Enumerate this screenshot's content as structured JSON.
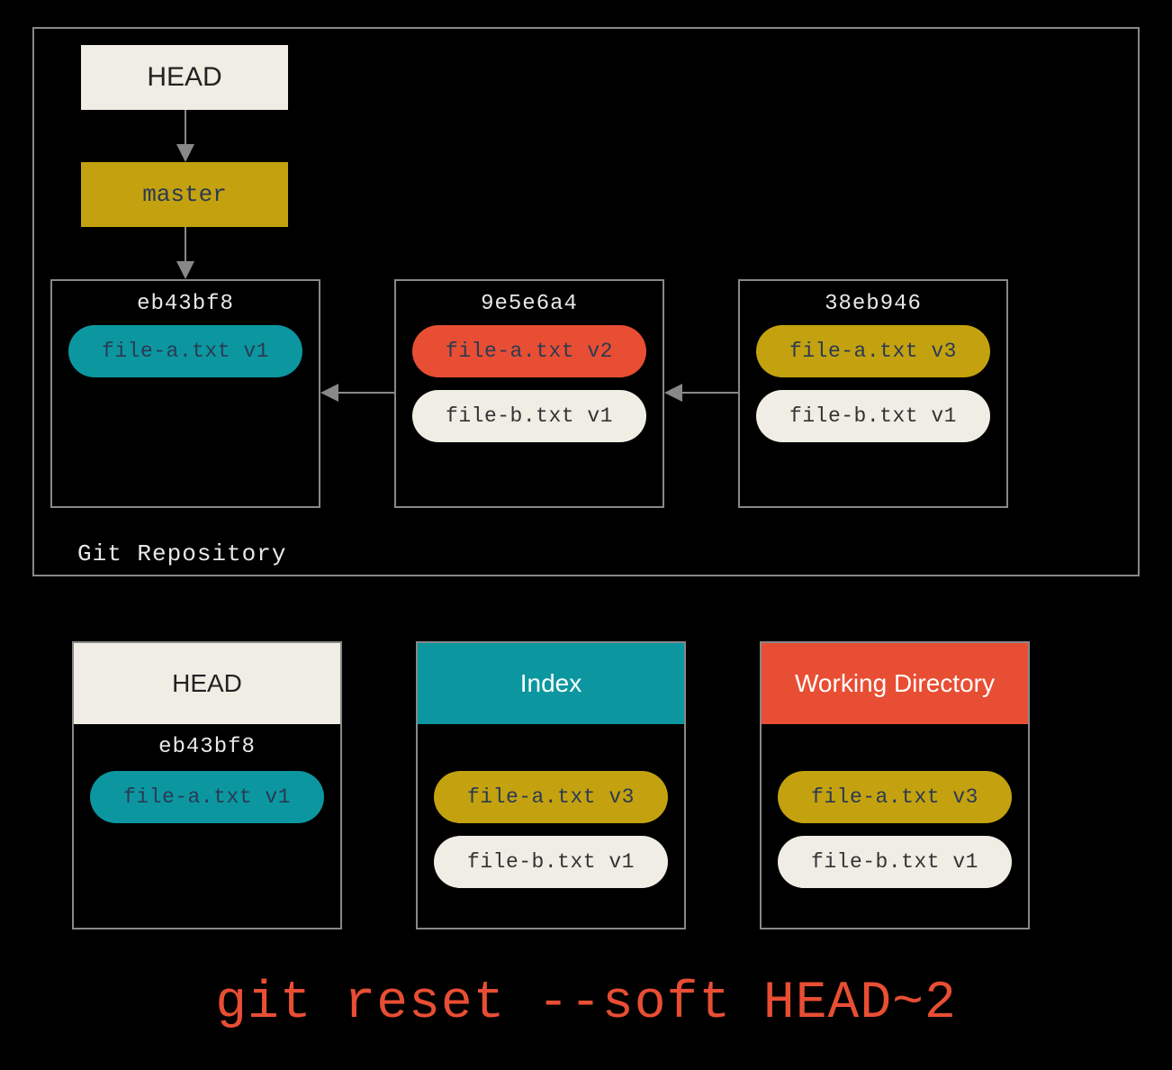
{
  "repo": {
    "label": "Git Repository",
    "head_label": "HEAD",
    "branch_label": "master",
    "commits": [
      {
        "hash": "eb43bf8",
        "files": [
          {
            "label": "file-a.txt v1",
            "color": "teal"
          }
        ]
      },
      {
        "hash": "9e5e6a4",
        "files": [
          {
            "label": "file-a.txt v2",
            "color": "red"
          },
          {
            "label": "file-b.txt v1",
            "color": "cream"
          }
        ]
      },
      {
        "hash": "38eb946",
        "files": [
          {
            "label": "file-a.txt v3",
            "color": "gold"
          },
          {
            "label": "file-b.txt v1",
            "color": "cream"
          }
        ]
      }
    ]
  },
  "panels": {
    "head": {
      "title": "HEAD",
      "hash": "eb43bf8",
      "files": [
        {
          "label": "file-a.txt v1",
          "color": "teal"
        }
      ]
    },
    "index": {
      "title": "Index",
      "hash": "",
      "files": [
        {
          "label": "file-a.txt v3",
          "color": "gold"
        },
        {
          "label": "file-b.txt v1",
          "color": "cream"
        }
      ]
    },
    "wd": {
      "title": "Working Directory",
      "hash": "",
      "files": [
        {
          "label": "file-a.txt v3",
          "color": "gold"
        },
        {
          "label": "file-b.txt v1",
          "color": "cream"
        }
      ]
    }
  },
  "command": "git reset --soft HEAD~2",
  "colors": {
    "teal": "#0c97a0",
    "red": "#e84e33",
    "gold": "#c4a20f",
    "cream": "#efede4",
    "text_dark": "#2a3a52"
  }
}
